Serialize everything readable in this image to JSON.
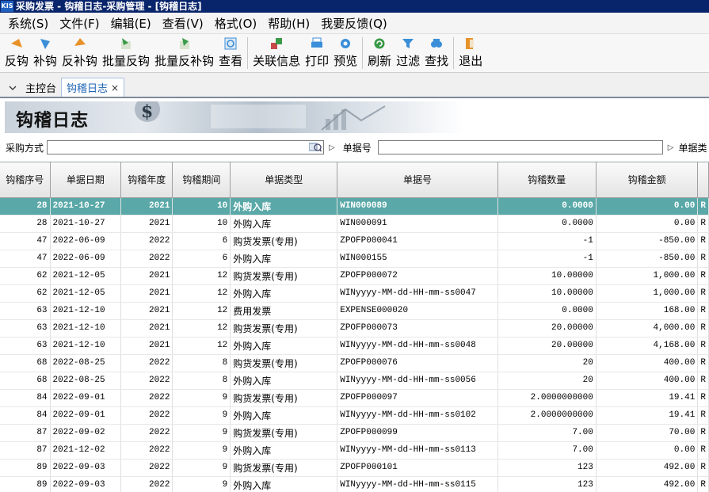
{
  "window": {
    "title": "采购发票 - 钩稽日志-采购管理 - [钩稽日志]",
    "app_badge": "KIS"
  },
  "menu": [
    "系统(S)",
    "文件(F)",
    "编辑(E)",
    "查看(V)",
    "格式(O)",
    "帮助(H)",
    "我要反馈(Q)"
  ],
  "toolbar": {
    "buttons": [
      {
        "label": "反钩",
        "icon": "unhook-icon",
        "color": "#e8922a"
      },
      {
        "label": "补钩",
        "icon": "rehook-icon",
        "color": "#3b8ed8"
      },
      {
        "label": "反补钩",
        "icon": "unrehook-icon",
        "color": "#e8922a"
      },
      {
        "label": "批量反钩",
        "icon": "batch-unhook-icon",
        "color": "#3a9a48"
      },
      {
        "label": "批量反补钩",
        "icon": "batch-unrehook-icon",
        "color": "#3a9a48"
      },
      {
        "label": "查看",
        "icon": "view-icon",
        "color": "#3b8ed8"
      },
      {
        "label": "关联信息",
        "icon": "link-info-icon",
        "color": "#3a9a48"
      },
      {
        "label": "打印",
        "icon": "print-icon",
        "color": "#3b8ed8"
      },
      {
        "label": "预览",
        "icon": "preview-icon",
        "color": "#3b8ed8"
      },
      {
        "label": "刷新",
        "icon": "refresh-icon",
        "color": "#3a9a48"
      },
      {
        "label": "过滤",
        "icon": "filter-icon",
        "color": "#3b8ed8"
      },
      {
        "label": "查找",
        "icon": "find-icon",
        "color": "#3b8ed8"
      },
      {
        "label": "退出",
        "icon": "exit-icon",
        "color": "#e8922a"
      }
    ]
  },
  "tabs": [
    {
      "label": "主控台",
      "active": false
    },
    {
      "label": "钩稽日志",
      "active": true,
      "close": "×"
    }
  ],
  "banner": {
    "title": "钩稽日志"
  },
  "filters": {
    "purchase_method_label": "采购方式",
    "doc_no_label": "单据号",
    "doc_type_label": "单据类"
  },
  "grid": {
    "columns": [
      "钩稽序号",
      "单据日期",
      "钩稽年度",
      "钩稽期间",
      "单据类型",
      "单据号",
      "钩稽数量",
      "钩稽金额"
    ],
    "rows": [
      [
        "28",
        "2021-10-27",
        "2021",
        "10",
        "外购入库",
        "WIN000089",
        "0.0000",
        "0.00",
        "R"
      ],
      [
        "28",
        "2021-10-27",
        "2021",
        "10",
        "外购入库",
        "WIN000091",
        "0.0000",
        "0.00",
        "R"
      ],
      [
        "47",
        "2022-06-09",
        "2022",
        "6",
        "购货发票(专用)",
        "ZPOFP000041",
        "-1",
        "-850.00",
        "R"
      ],
      [
        "47",
        "2022-06-09",
        "2022",
        "6",
        "外购入库",
        "WIN000155",
        "-1",
        "-850.00",
        "R"
      ],
      [
        "62",
        "2021-12-05",
        "2021",
        "12",
        "购货发票(专用)",
        "ZPOFP000072",
        "10.00000",
        "1,000.00",
        "R"
      ],
      [
        "62",
        "2021-12-05",
        "2021",
        "12",
        "外购入库",
        "WINyyyy-MM-dd-HH-mm-ss0047",
        "10.00000",
        "1,000.00",
        "R"
      ],
      [
        "63",
        "2021-12-10",
        "2021",
        "12",
        "费用发票",
        "EXPENSE000020",
        "0.0000",
        "168.00",
        "R"
      ],
      [
        "63",
        "2021-12-10",
        "2021",
        "12",
        "购货发票(专用)",
        "ZPOFP000073",
        "20.00000",
        "4,000.00",
        "R"
      ],
      [
        "63",
        "2021-12-10",
        "2021",
        "12",
        "外购入库",
        "WINyyyy-MM-dd-HH-mm-ss0048",
        "20.00000",
        "4,168.00",
        "R"
      ],
      [
        "68",
        "2022-08-25",
        "2022",
        "8",
        "购货发票(专用)",
        "ZPOFP000076",
        "20",
        "400.00",
        "R"
      ],
      [
        "68",
        "2022-08-25",
        "2022",
        "8",
        "外购入库",
        "WINyyyy-MM-dd-HH-mm-ss0056",
        "20",
        "400.00",
        "R"
      ],
      [
        "84",
        "2022-09-01",
        "2022",
        "9",
        "购货发票(专用)",
        "ZPOFP000097",
        "2.0000000000",
        "19.41",
        "R"
      ],
      [
        "84",
        "2022-09-01",
        "2022",
        "9",
        "外购入库",
        "WINyyyy-MM-dd-HH-mm-ss0102",
        "2.0000000000",
        "19.41",
        "R"
      ],
      [
        "87",
        "2022-09-02",
        "2022",
        "9",
        "购货发票(专用)",
        "ZPOFP000099",
        "7.00",
        "70.00",
        "R"
      ],
      [
        "87",
        "2021-12-02",
        "2022",
        "9",
        "外购入库",
        "WINyyyy-MM-dd-HH-mm-ss0113",
        "7.00",
        "0.00",
        "R"
      ],
      [
        "89",
        "2022-09-03",
        "2022",
        "9",
        "购货发票(专用)",
        "ZPOFP000101",
        "123",
        "492.00",
        "R"
      ],
      [
        "89",
        "2022-09-03",
        "2022",
        "9",
        "外购入库",
        "WINyyyy-MM-dd-HH-mm-ss0115",
        "123",
        "492.00",
        "R"
      ]
    ],
    "selected_row": 0
  },
  "colors": {
    "selected_row_bg": "#5aa8a8",
    "title_bar_bg": "#08246b",
    "active_tab_text": "#1e64b4"
  }
}
